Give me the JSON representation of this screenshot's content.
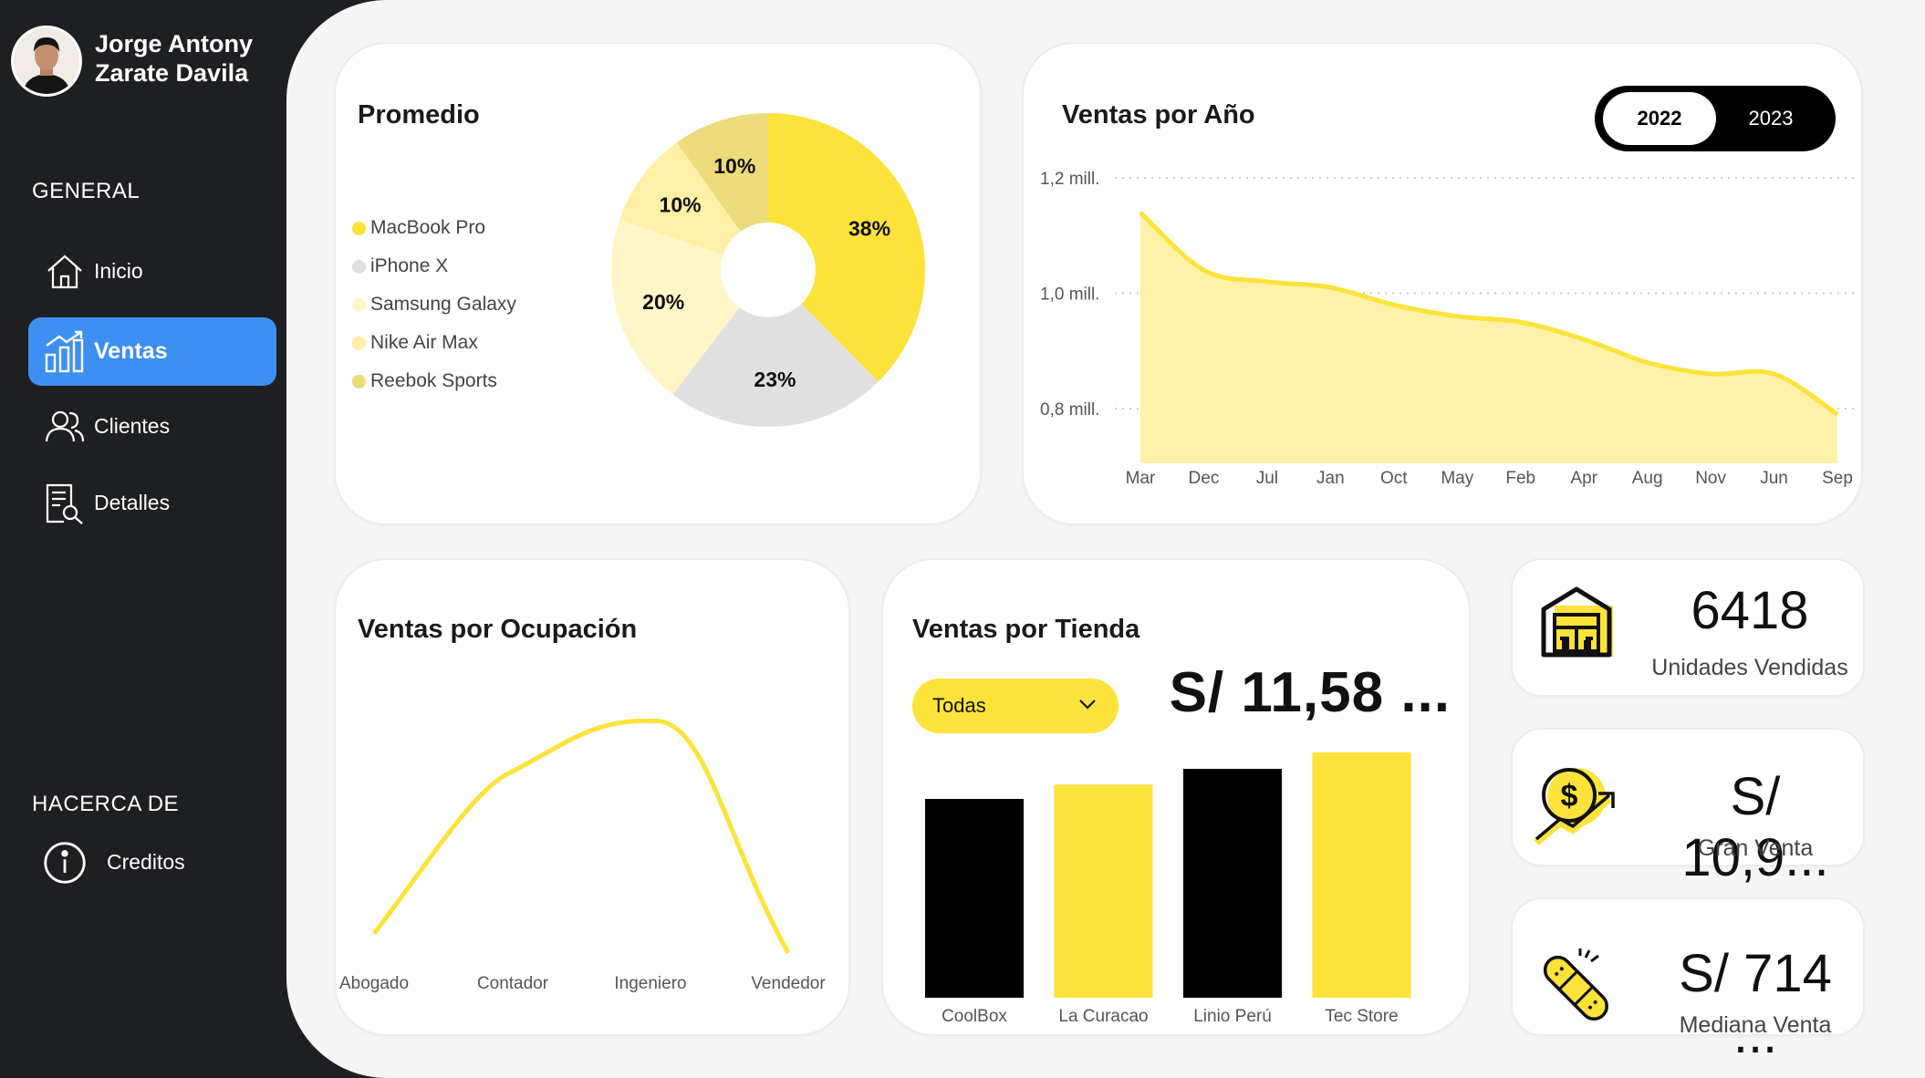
{
  "user": {
    "name_line1": "Jorge Antony",
    "name_line2": "Zarate Davila"
  },
  "sidebar": {
    "general_label": "GENERAL",
    "items": [
      {
        "label": "Inicio",
        "icon": "home-icon",
        "active": false
      },
      {
        "label": "Ventas",
        "icon": "bar-chart-icon",
        "active": true
      },
      {
        "label": "Clientes",
        "icon": "users-icon",
        "active": false
      },
      {
        "label": "Detalles",
        "icon": "document-search-icon",
        "active": false
      }
    ],
    "about_label": "HACERCA DE",
    "about_items": [
      {
        "label": "Creditos",
        "icon": "info-icon"
      }
    ]
  },
  "colors": {
    "yellow": "#fde23a",
    "active_blue": "#3d8ff2",
    "black": "#000000",
    "gray": "#e0e0e0",
    "light_yellow": "#fff2a8",
    "area_fill": "#fff0a6"
  },
  "promedio": {
    "title": "Promedio",
    "legend": [
      {
        "label": "MacBook Pro",
        "color": "#fde23a"
      },
      {
        "label": "iPhone X",
        "color": "#e0e0e0"
      },
      {
        "label": "Samsung Galaxy",
        "color": "#fff5c7"
      },
      {
        "label": "Nike Air Max",
        "color": "#fff0a6"
      },
      {
        "label": "Reebok Sports",
        "color": "#ebdb7a"
      }
    ]
  },
  "ventas_anio": {
    "title": "Ventas por Año",
    "years": [
      "2022",
      "2023"
    ],
    "selected_year": "2022"
  },
  "ventas_ocupacion": {
    "title": "Ventas por Ocupación"
  },
  "ventas_tienda": {
    "title": "Ventas por Tienda",
    "dropdown_value": "Todas",
    "total": "S/ 11,58 ..."
  },
  "kpis": [
    {
      "value": "6418",
      "label": "Unidades Vendidas",
      "icon": "warehouse-icon"
    },
    {
      "value": "S/ 10,9...",
      "label": "Gran Venta",
      "icon": "money-growth-icon"
    },
    {
      "value": "S/ 714 ...",
      "label": "Mediana Venta",
      "icon": "bandage-icon"
    }
  ],
  "chart_data": [
    {
      "type": "pie",
      "title": "Promedio",
      "categories": [
        "MacBook Pro",
        "iPhone X",
        "Samsung Galaxy",
        "Nike Air Max",
        "Reebok Sports"
      ],
      "values": [
        38,
        23,
        20,
        10,
        10
      ],
      "value_labels": [
        "38%",
        "23%",
        "20%",
        "10%",
        "10%"
      ],
      "colors": [
        "#fde23a",
        "#e0e0e0",
        "#fff5c7",
        "#fff0a6",
        "#ebdb7a"
      ],
      "donut": true
    },
    {
      "type": "area",
      "title": "Ventas por Año",
      "categories": [
        "Mar",
        "Dec",
        "Jul",
        "Jan",
        "Oct",
        "May",
        "Feb",
        "Apr",
        "Aug",
        "Nov",
        "Jun",
        "Sep"
      ],
      "values": [
        1.14,
        1.04,
        1.02,
        1.01,
        0.98,
        0.96,
        0.95,
        0.92,
        0.88,
        0.86,
        0.86,
        0.79
      ],
      "y_ticks": [
        {
          "value": 1.2,
          "label": "1,2 mill."
        },
        {
          "value": 1.0,
          "label": "1,0 mill."
        },
        {
          "value": 0.8,
          "label": "0,8 mill."
        }
      ],
      "ylim": [
        0.7,
        1.2
      ],
      "grid": true,
      "color": "#fde23a"
    },
    {
      "type": "line",
      "title": "Ventas por Ocupación",
      "categories": [
        "Abogado",
        "Contador",
        "Ingeniero",
        "Vendedor"
      ],
      "values": [
        0.1,
        0.78,
        0.99,
        0.02
      ],
      "ylim": [
        0,
        1
      ],
      "color": "#fde23a"
    },
    {
      "type": "bar",
      "title": "Ventas por Tienda",
      "categories": [
        "CoolBox",
        "La Curacao",
        "Linio Perú",
        "Tec Store"
      ],
      "values": [
        2.65,
        2.84,
        3.05,
        3.27
      ],
      "ylim": [
        0,
        3.5
      ],
      "colors": [
        "#000000",
        "#fde23a",
        "#000000",
        "#fde23a"
      ]
    }
  ]
}
